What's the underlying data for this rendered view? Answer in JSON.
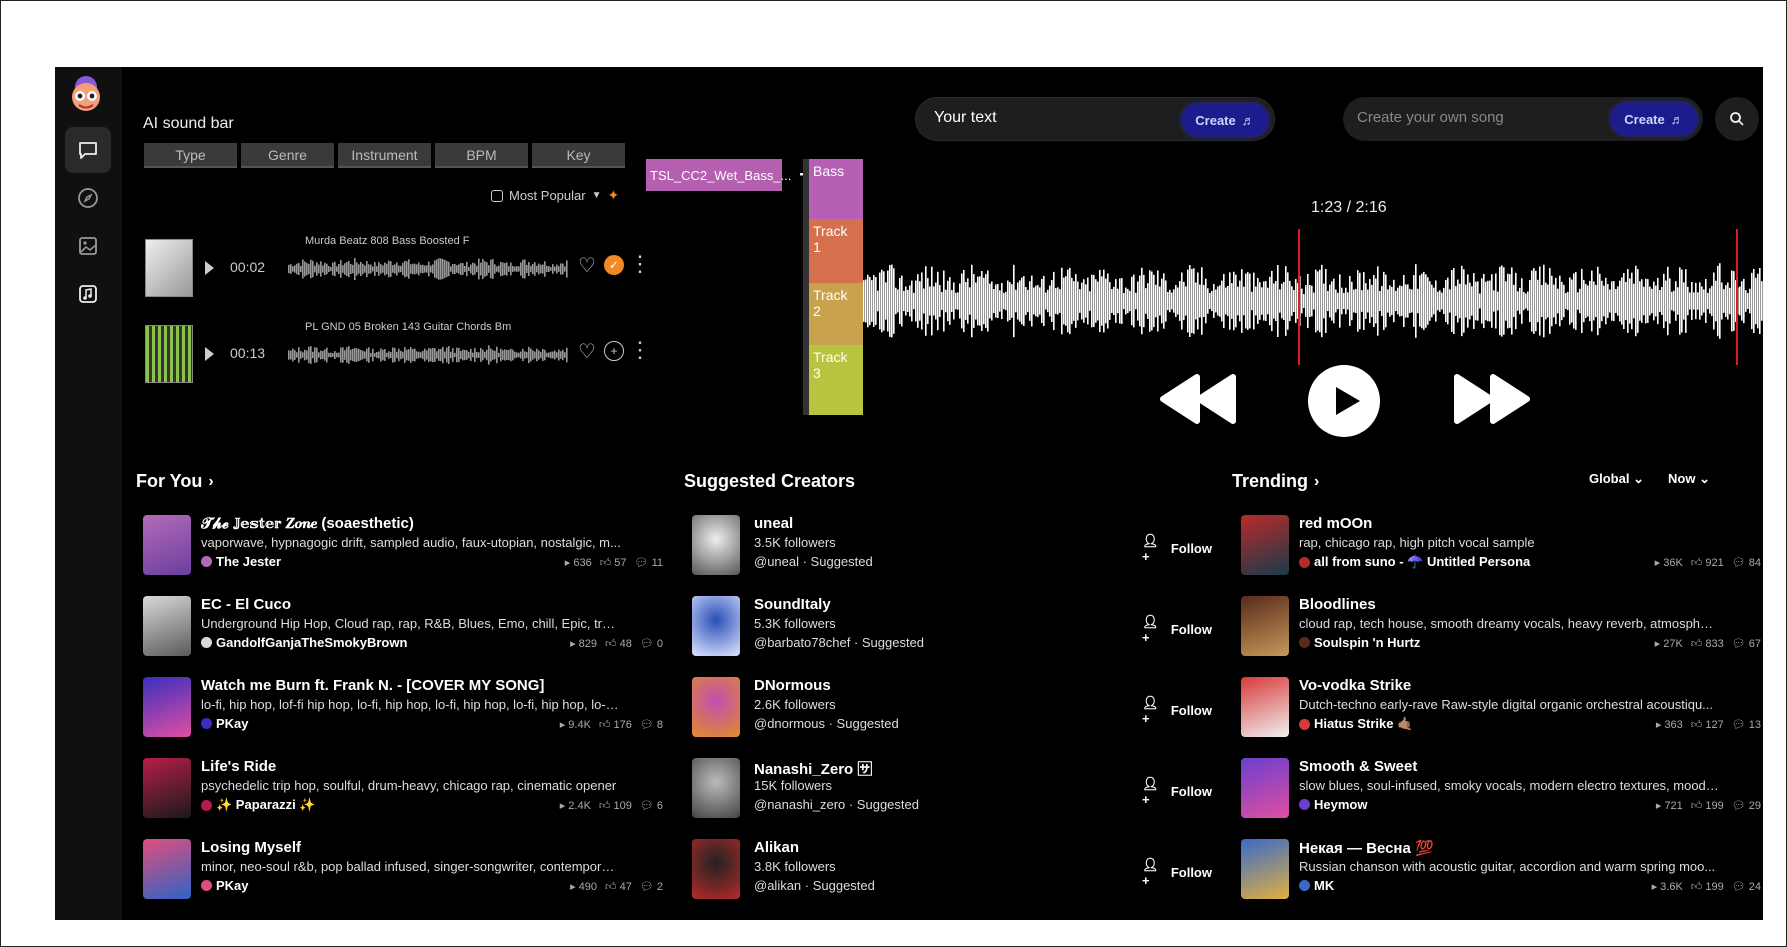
{
  "soundbar": {
    "title": "AI sound bar",
    "filters": [
      "Type",
      "Genre",
      "Instrument",
      "BPM",
      "Key"
    ],
    "sort_label": "Most Popular",
    "tracks": [
      {
        "title": "Murda Beatz 808 Bass Boosted F",
        "time": "00:02",
        "liked": false,
        "added": true
      },
      {
        "title": "PL GND 05 Broken 143 Guitar Chords Bm",
        "time": "00:13",
        "liked": false,
        "added": false
      }
    ]
  },
  "daw": {
    "clip_label": "TSL_CC2_Wet_Bass_...",
    "lanes": [
      {
        "label": "Bass",
        "color": "#b75fb4"
      },
      {
        "label": "Track 1",
        "color": "#d4704e"
      },
      {
        "label": "Track 2",
        "color": "#c9a24d"
      },
      {
        "label": "Track 3",
        "color": "#b8c33e"
      }
    ]
  },
  "hero": {
    "input_value": "Your text",
    "create_label": "Create"
  },
  "song_search": {
    "placeholder": "Create your own song",
    "create_label": "Create"
  },
  "player": {
    "timecode": "1:23 / 2:16",
    "progress": 0.61
  },
  "for_you": {
    "title": "For You",
    "items": [
      {
        "title": "𝓣𝓱𝓮 𝕁𝕖𝕤𝕥𝕖𝕣 𝒁𝒐𝒏𝒆 (soaesthetic)",
        "desc": "vaporwave, hypnagogic drift, sampled audio, faux-utopian, nostalgic, m...",
        "author": "The Jester",
        "plays": "636",
        "likes": "57",
        "comments": "11",
        "colors": [
          "#b36bb8",
          "#6a3f9e"
        ]
      },
      {
        "title": "EC - El Cuco",
        "desc": "Underground Hip Hop, Cloud rap, rap, R&B, Blues, Emo, chill, Epic, trap, ...",
        "author": "GandolfGanjaTheSmokyBrown",
        "plays": "829",
        "likes": "48",
        "comments": "0",
        "colors": [
          "#d9d9d9",
          "#5a5a5a"
        ]
      },
      {
        "title": "Watch me Burn ft. Frank N. - [COVER MY SONG]",
        "desc": "lo-fi, hip hop, lof-fi hip hop, lo-fi, hip hop, lo-fi, hip hop, lo-fi, hip hop, lo-fi, h...",
        "author": "PKay",
        "plays": "9.4K",
        "likes": "176",
        "comments": "8",
        "colors": [
          "#3a2fbf",
          "#e04fa0"
        ]
      },
      {
        "title": "Life's Ride",
        "desc": "psychedelic trip hop, soulful, drum-heavy, chicago rap, cinematic opener",
        "author": "✨ Paparazzi ✨",
        "plays": "2.4K",
        "likes": "109",
        "comments": "6",
        "colors": [
          "#b51e4a",
          "#1a1a1a"
        ]
      },
      {
        "title": "Losing Myself",
        "desc": "minor, neo-soul r&b, pop ballad infused, singer-songwriter, contemporar...",
        "author": "PKay",
        "plays": "490",
        "likes": "47",
        "comments": "2",
        "colors": [
          "#e04f7c",
          "#2f63c4"
        ]
      }
    ]
  },
  "creators": {
    "title": "Suggested Creators",
    "follow_label": "Follow",
    "items": [
      {
        "name": "uneal",
        "followers": "3.5K followers",
        "handle": "@uneal · Suggested",
        "colors": [
          "#eeeeee",
          "#555555"
        ]
      },
      {
        "name": "SoundItaly",
        "followers": "5.3K followers",
        "handle": "@barbato78chef · Suggested",
        "colors": [
          "#2a4fb8",
          "#dfe6ff"
        ]
      },
      {
        "name": "DNormous",
        "followers": "2.6K followers",
        "handle": "@dnormous · Suggested",
        "colors": [
          "#c24fb0",
          "#e08c2a"
        ]
      },
      {
        "name": "Nanashi_Zero 🈂",
        "followers": "15K followers",
        "handle": "@nanashi_zero · Suggested",
        "colors": [
          "#bbbbbb",
          "#444444"
        ]
      },
      {
        "name": "Alikan",
        "followers": "3.8K followers",
        "handle": "@alikan · Suggested",
        "colors": [
          "#222222",
          "#b52a2a"
        ]
      }
    ]
  },
  "trending": {
    "title": "Trending",
    "region_filter": "Global",
    "time_filter": "Now",
    "items": [
      {
        "title": "red mOOn",
        "desc": "rap, chicago rap, high pitch vocal sample",
        "author": "all from suno - ☂️ Untitled Persona",
        "plays": "36K",
        "likes": "921",
        "comments": "84",
        "colors": [
          "#b82a2a",
          "#1a3a4a"
        ]
      },
      {
        "title": "Bloodlines",
        "desc": "cloud rap, tech house, smooth dreamy vocals, heavy reverb, atmospheri...",
        "author": "Soulspin 'n Hurtz",
        "plays": "27K",
        "likes": "833",
        "comments": "67",
        "colors": [
          "#5a2a1a",
          "#c49a5a"
        ]
      },
      {
        "title": "Vo-vodka Strike",
        "desc": "Dutch-techno early-rave Raw-style digital organic orchestral acoustiqu...",
        "author": "Hiatus Strike 🤙🏽",
        "plays": "363",
        "likes": "127",
        "comments": "13",
        "colors": [
          "#d83a3a",
          "#f0f0f0"
        ]
      },
      {
        "title": "Smooth & Sweet",
        "desc": "slow blues, soul-infused, smoky vocals, modern electro textures, moody...",
        "author": "Heymow",
        "plays": "721",
        "likes": "199",
        "comments": "29",
        "colors": [
          "#6a3fd0",
          "#e04fa0"
        ]
      },
      {
        "title": "Некая — Весна 💯",
        "desc": "Russian chanson with acoustic guitar, accordion and warm spring moo...",
        "author": "MK",
        "plays": "3.6K",
        "likes": "199",
        "comments": "24",
        "colors": [
          "#3a6ac8",
          "#e0b040"
        ]
      }
    ]
  }
}
